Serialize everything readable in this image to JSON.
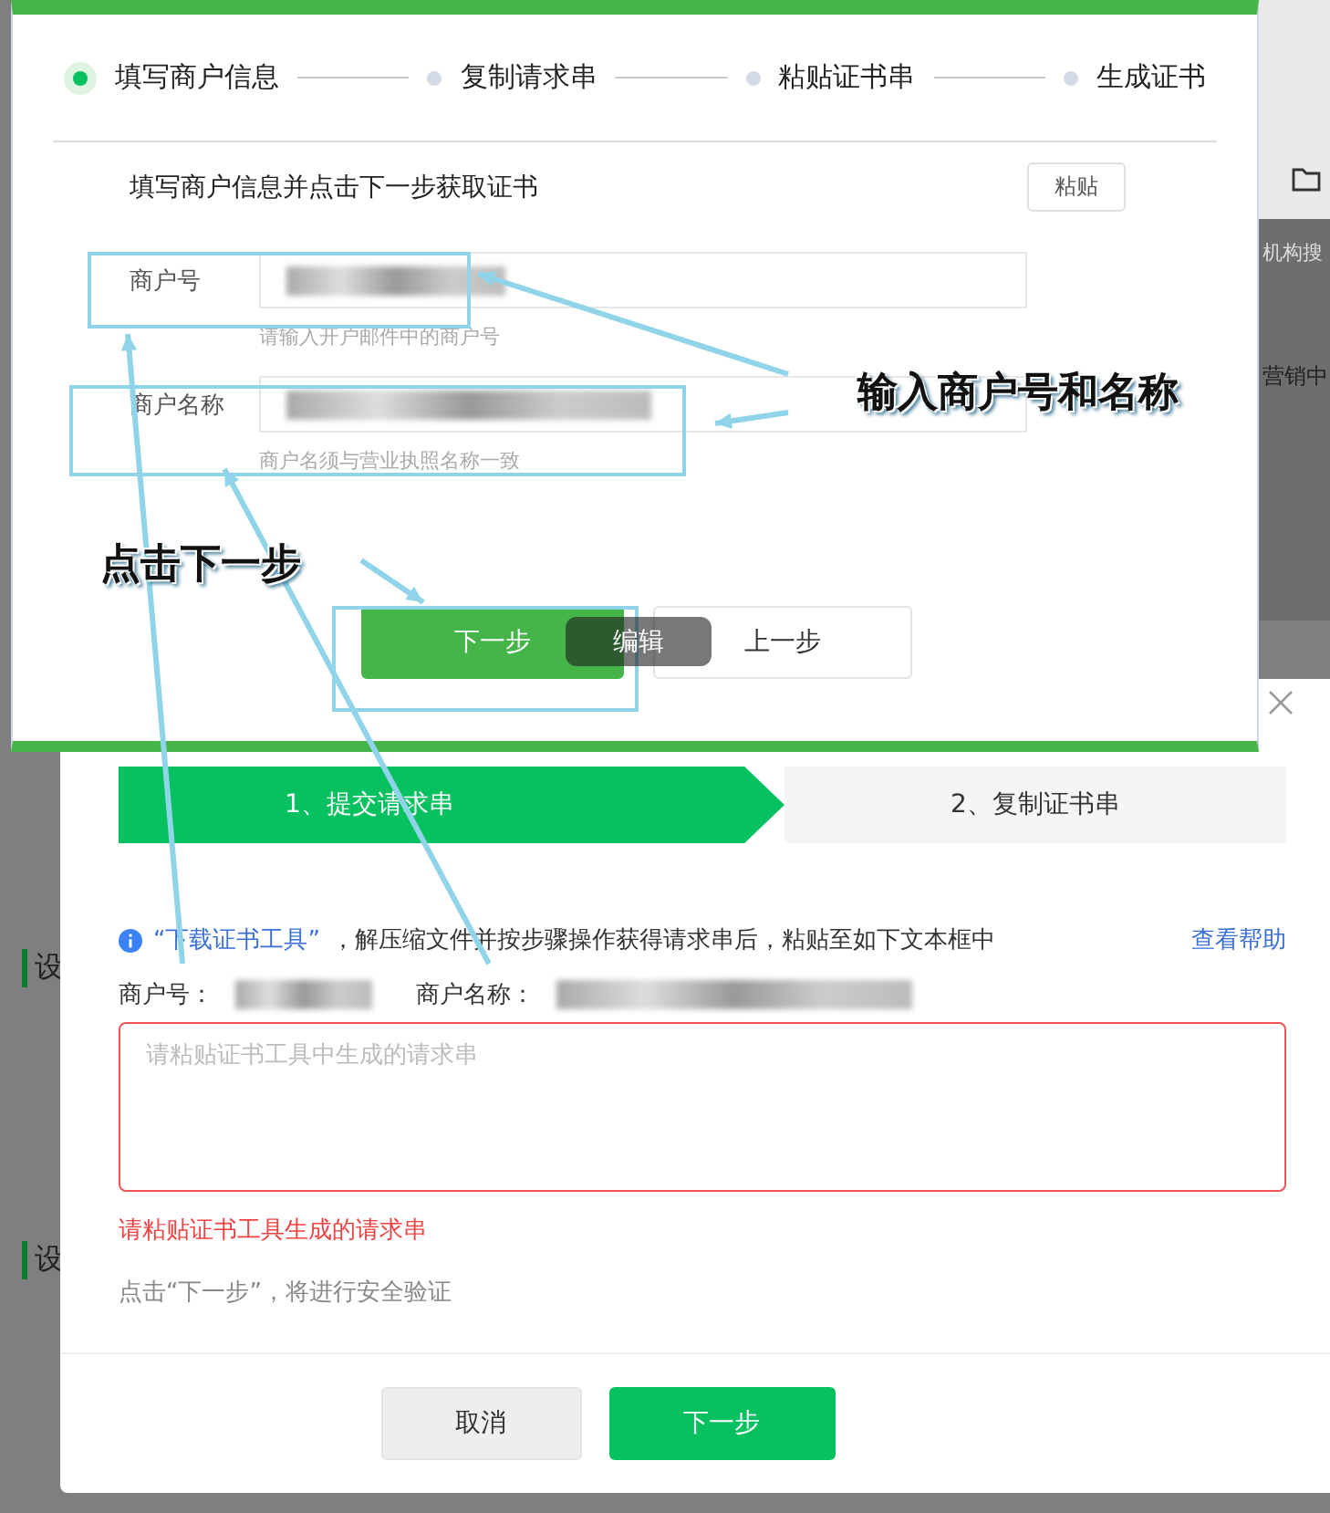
{
  "background_page": {
    "section_fragments": [
      "设",
      "设"
    ],
    "right_fragments": [
      "机构搜",
      "营销中"
    ]
  },
  "dialog": {
    "steps": [
      {
        "label": "1、提交请求串",
        "selected": true
      },
      {
        "label": "2、复制证书串",
        "selected": false
      }
    ],
    "info": {
      "link": "“下载证书工具”",
      "text": "，解压缩文件并按步骤操作获得请求串后，粘贴至如下文本框中",
      "help_link": "查看帮助"
    },
    "merchant_id_label": "商户号：",
    "merchant_name_label": "商户名称：",
    "request_field": {
      "placeholder": "请粘贴证书工具中生成的请求串",
      "invalid": true
    },
    "error": "请粘贴证书工具生成的请求串",
    "hint": "点击“下一步”，将进行安全验证",
    "buttons": [
      {
        "label": "取消",
        "kind": "secondary"
      },
      {
        "label": "下一步",
        "kind": "primary"
      }
    ]
  },
  "overlay_window": {
    "steps": [
      {
        "label": "填写商户信息",
        "selected": true
      },
      {
        "label": "复制请求串",
        "selected": false
      },
      {
        "label": "粘贴证书串",
        "selected": false
      },
      {
        "label": "生成证书",
        "selected": false
      }
    ],
    "title": "填写商户信息并点击下一步获取证书",
    "paste_button": "粘贴",
    "fields": [
      {
        "label": "商户号",
        "help": "请输入开户邮件中的商户号"
      },
      {
        "label": "商户名称",
        "help": "商户名须与营业执照名称一致"
      }
    ],
    "buttons": [
      {
        "label": "下一步",
        "kind": "primary"
      },
      {
        "label": "上一步",
        "kind": "secondary"
      }
    ],
    "tooltip": "编辑"
  },
  "annotations": [
    {
      "text": "输入商户号和名称",
      "kind": "right"
    },
    {
      "text": "点击下一步",
      "kind": "left"
    }
  ]
}
